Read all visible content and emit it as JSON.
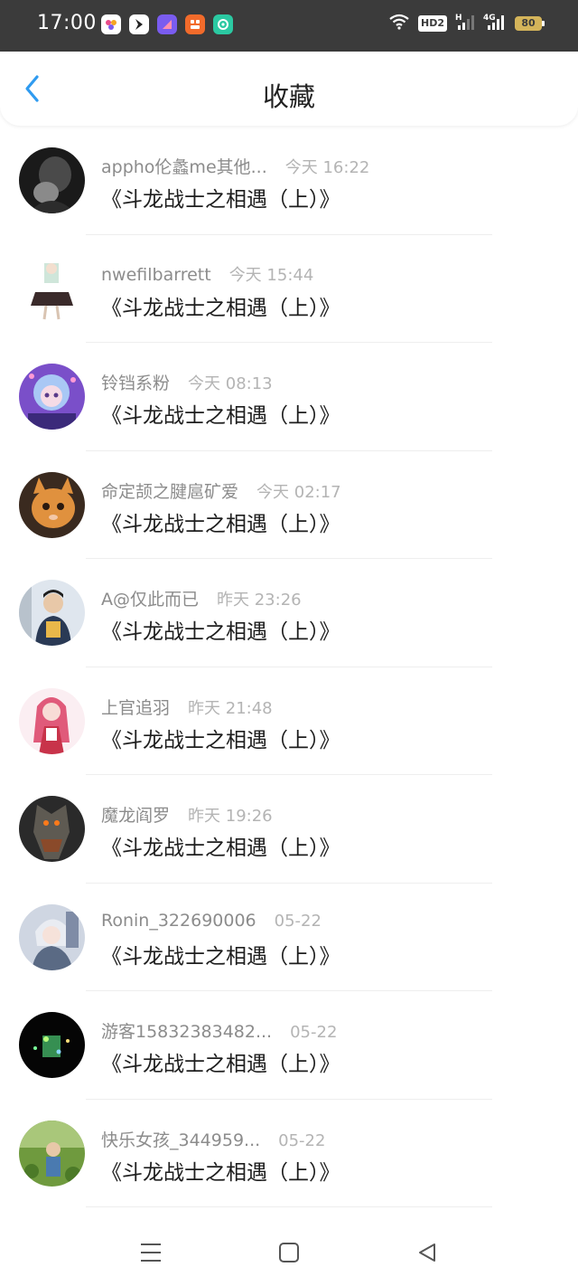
{
  "status_bar": {
    "time": "17:00",
    "app_icons": [
      {
        "name": "app1-icon",
        "color": "#ffffff"
      },
      {
        "name": "app2-icon",
        "color": "#ffffff"
      },
      {
        "name": "app3-icon",
        "color": "#7a5cf0"
      },
      {
        "name": "app4-icon",
        "color": "#f26b2b"
      },
      {
        "name": "app5-icon",
        "color": "#2bc9a2"
      }
    ],
    "hd_label": "HD2",
    "network_label": "4G",
    "battery": "80"
  },
  "header": {
    "title": "收藏",
    "back_icon": "chevron-left-icon",
    "accent_color": "#2f9bf0"
  },
  "favorites": [
    {
      "user": "appho伦蠡me其他...",
      "time": "今天 16:22",
      "title": "《斗龙战士之相遇（上）》"
    },
    {
      "user": "nwefilbarrett",
      "time": "今天 15:44",
      "title": "《斗龙战士之相遇（上）》"
    },
    {
      "user": "铃铛系粉",
      "time": "今天 08:13",
      "title": "《斗龙战士之相遇（上）》"
    },
    {
      "user": "命定颉之腱扈矿爱",
      "time": "今天 02:17",
      "title": "《斗龙战士之相遇（上）》"
    },
    {
      "user": "A󠀠@仅此而已",
      "time": "昨天 23:26",
      "title": "《斗龙战士之相遇（上）》"
    },
    {
      "user": "上官追羽",
      "time": "昨天 21:48",
      "title": "《斗龙战士之相遇（上）》"
    },
    {
      "user": "魔龙阎罗",
      "time": "昨天 19:26",
      "title": "《斗龙战士之相遇（上）》"
    },
    {
      "user": "Ronin_322690006",
      "time": "05-22",
      "title": "《斗龙战士之相遇（上）》"
    },
    {
      "user": "游客15832383482...",
      "time": "05-22",
      "title": "《斗龙战士之相遇（上）》"
    },
    {
      "user": "快乐女孩_344959...",
      "time": "05-22",
      "title": "《斗龙战士之相遇（上）》"
    }
  ],
  "nav": {
    "menu_icon": "menu-icon",
    "home_icon": "home-square-icon",
    "back_icon": "back-triangle-icon"
  }
}
